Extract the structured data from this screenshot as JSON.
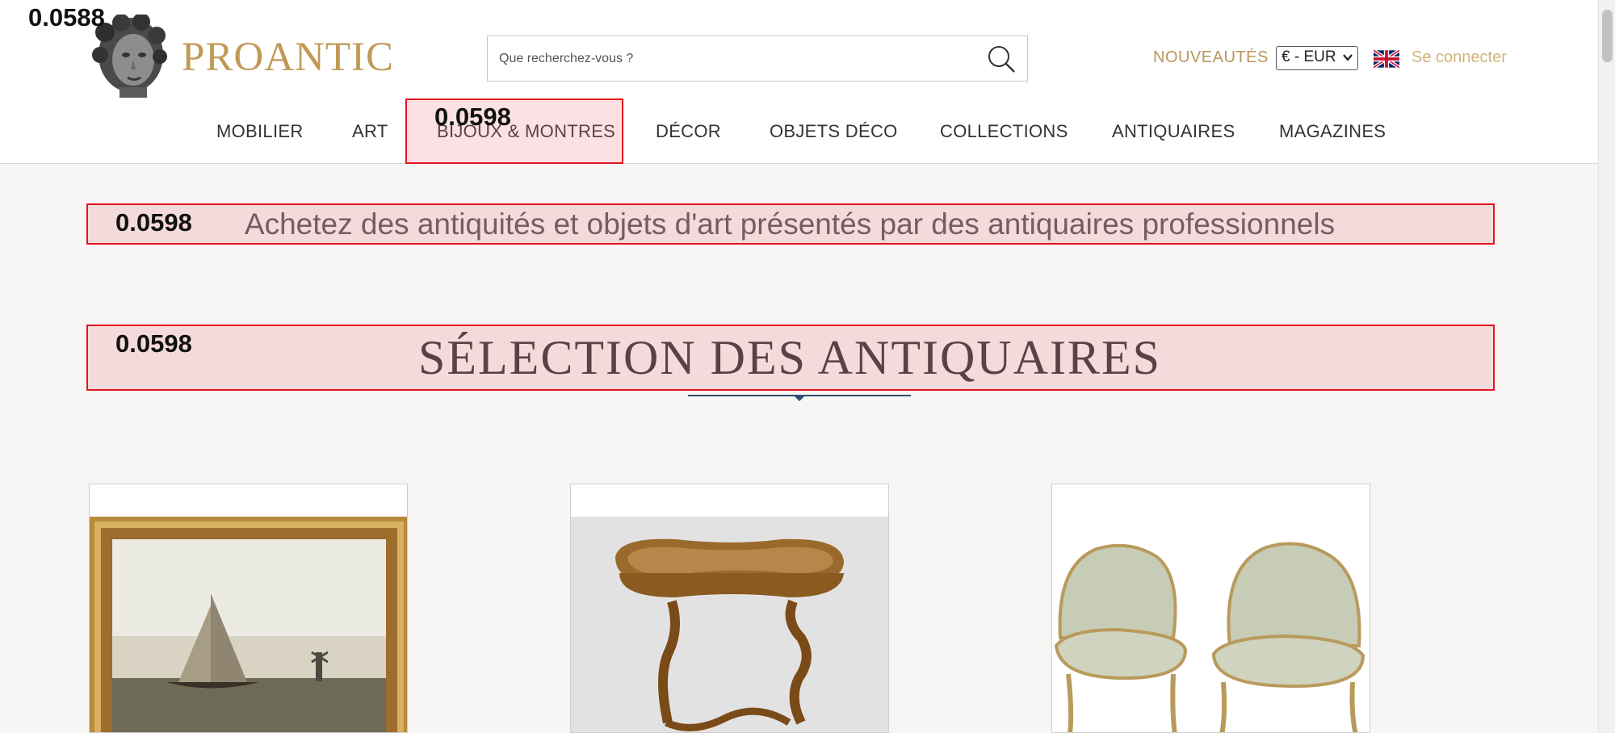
{
  "header": {
    "logo_text": "PROANTIC",
    "search_placeholder": "Que recherchez-vous ?",
    "new_label": "NOUVEAUTÉS",
    "currency_value": "€ - EUR",
    "login_label": "Se connecter"
  },
  "nav": {
    "items": [
      "MOBILIER",
      "ART",
      "BIJOUX & MONTRES",
      "DÉCOR",
      "OBJETS DÉCO",
      "COLLECTIONS",
      "ANTIQUAIRES",
      "MAGAZINES"
    ]
  },
  "main": {
    "tagline": "Achetez des antiquités et objets d'art présentés par des antiquaires professionnels",
    "section_title": "SÉLECTION DES ANTIQUAIRES"
  },
  "overlay_scores": {
    "logo": "0.0588",
    "nav_bijoux": "0.0598",
    "tagline": "0.0598",
    "section_title": "0.0598"
  },
  "icons": {
    "search": "search-icon",
    "flag": "uk-flag-icon",
    "logo": "bust-logo-icon"
  },
  "colors": {
    "gold": "#c09a55",
    "highlight_border": "#e3141f",
    "divider": "#2f4f6f"
  }
}
